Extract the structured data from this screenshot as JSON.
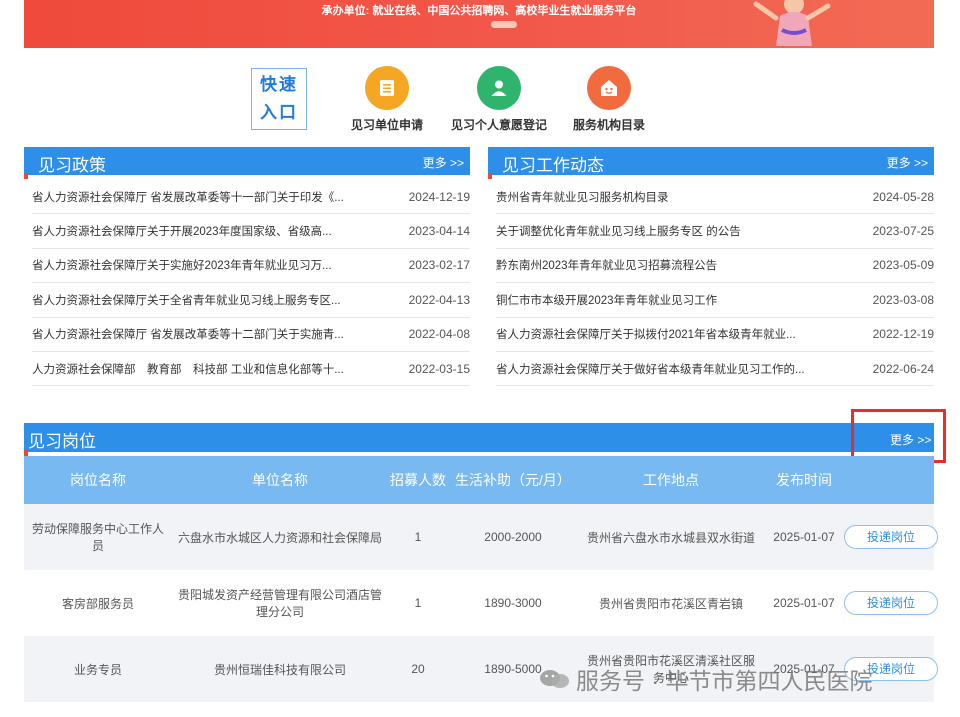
{
  "banner": {
    "text": "承办单位: 就业在线、中国公共招聘网、高校毕业生就业服务平台"
  },
  "quick_entry": {
    "logo_line1": "快速",
    "logo_line2": "入口",
    "items": [
      {
        "label": "见习单位申请",
        "icon": "document-list-icon",
        "color": "#f5a623"
      },
      {
        "label": "见习个人意愿登记",
        "icon": "person-icon",
        "color": "#2fb46d"
      },
      {
        "label": "服务机构目录",
        "icon": "house-icon",
        "color": "#f26b3f"
      }
    ]
  },
  "policy": {
    "title": "见习政策",
    "more": "更多 >>",
    "items": [
      {
        "title": "省人力资源社会保障厅 省发展改革委等十一部门关于印发《...",
        "date": "2024-12-19"
      },
      {
        "title": "省人力资源社会保障厅关于开展2023年度国家级、省级高...",
        "date": "2023-04-14"
      },
      {
        "title": "省人力资源社会保障厅关于实施好2023年青年就业见习万...",
        "date": "2023-02-17"
      },
      {
        "title": "省人力资源社会保障厅关于全省青年就业见习线上服务专区...",
        "date": "2022-04-13"
      },
      {
        "title": "省人力资源社会保障厅 省发展改革委等十二部门关于实施青...",
        "date": "2022-04-08"
      },
      {
        "title": "人力资源社会保障部　教育部　科技部 工业和信息化部等十...",
        "date": "2022-03-15"
      }
    ]
  },
  "news": {
    "title": "见习工作动态",
    "more": "更多 >>",
    "items": [
      {
        "title": "贵州省青年就业见习服务机构目录",
        "date": "2024-05-28"
      },
      {
        "title": "关于调整优化青年就业见习线上服务专区 的公告",
        "date": "2023-07-25"
      },
      {
        "title": "黔东南州2023年青年就业见习招募流程公告",
        "date": "2023-05-09"
      },
      {
        "title": "铜仁市市本级开展2023年青年就业见习工作",
        "date": "2023-03-08"
      },
      {
        "title": "省人力资源社会保障厅关于拟拨付2021年省本级青年就业...",
        "date": "2022-12-19"
      },
      {
        "title": "省人力资源社会保障厅关于做好省本级青年就业见习工作的...",
        "date": "2022-06-24"
      }
    ]
  },
  "jobs": {
    "title": "见习岗位",
    "more": "更多 >>",
    "headers": [
      "岗位名称",
      "单位名称",
      "招募人数",
      "生活补助（元/月）",
      "工作地点",
      "发布时间"
    ],
    "apply_label": "投递岗位",
    "rows": [
      {
        "position": "劳动保障服务中心工作人员",
        "company": "六盘水市水城区人力资源和社会保障局",
        "count": "1",
        "subsidy": "2000-2000",
        "location": "贵州省六盘水市水城县双水街道",
        "date": "2025-01-07"
      },
      {
        "position": "客房部服务员",
        "company": "贵阳城发资产经营管理有限公司酒店管理分公司",
        "count": "1",
        "subsidy": "1890-3000",
        "location": "贵州省贵阳市花溪区青岩镇",
        "date": "2025-01-07"
      },
      {
        "position": "业务专员",
        "company": "贵州恒瑞佳科技有限公司",
        "count": "20",
        "subsidy": "1890-5000",
        "location": "贵州省贵阳市花溪区清溪社区服务中心",
        "date": "2025-01-07"
      }
    ]
  },
  "watermark": {
    "text": "服务号 · 毕节市第四人民医院"
  }
}
